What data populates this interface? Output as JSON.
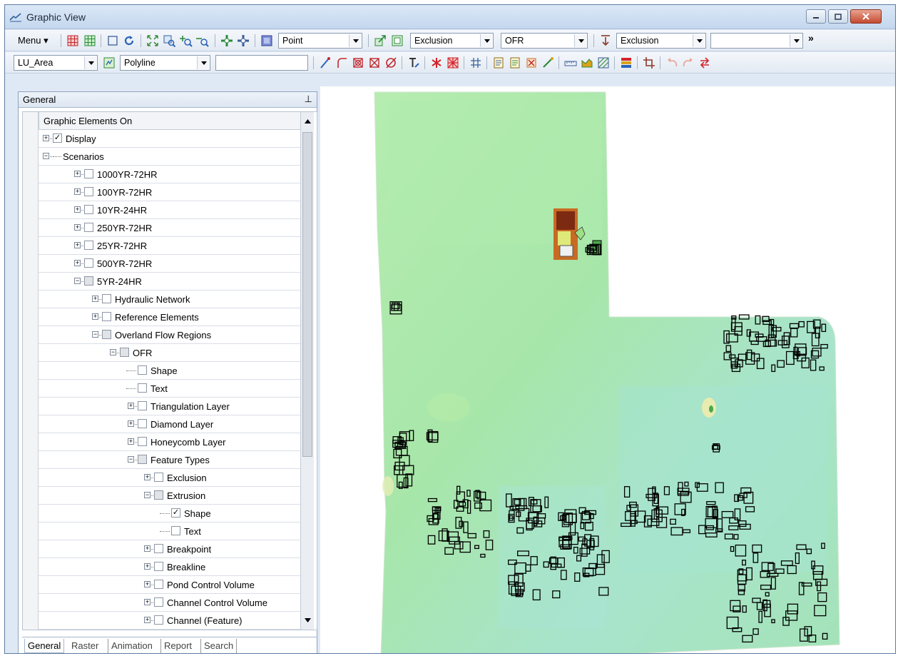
{
  "window": {
    "title": "Graphic View"
  },
  "toolbar1": {
    "menu_label": "Menu",
    "combo_point": "Point",
    "combo_exclusion1": "Exclusion",
    "combo_ofr": "OFR",
    "combo_exclusion2": "Exclusion",
    "combo_blank": "",
    "overflow": "»"
  },
  "toolbar2": {
    "combo_layer": "LU_Area",
    "combo_shape": "Polyline",
    "text_input": ""
  },
  "panel": {
    "title": "General",
    "pin": "⊥",
    "column_header": "Graphic Elements On",
    "tabs": [
      "General",
      "Raster",
      "Animation",
      "Report",
      "Search"
    ]
  },
  "tree": [
    {
      "label": "Display",
      "checked": true
    },
    {
      "label": "Scenarios",
      "checked": false
    },
    {
      "label": "1000YR-72HR"
    },
    {
      "label": "100YR-72HR"
    },
    {
      "label": "10YR-24HR"
    },
    {
      "label": "250YR-72HR"
    },
    {
      "label": "25YR-72HR"
    },
    {
      "label": "500YR-72HR"
    },
    {
      "label": "5YR-24HR"
    },
    {
      "label": "Hydraulic Network"
    },
    {
      "label": "Reference Elements"
    },
    {
      "label": "Overland Flow Regions"
    },
    {
      "label": "OFR"
    },
    {
      "label": "Shape"
    },
    {
      "label": "Text"
    },
    {
      "label": "Triangulation Layer"
    },
    {
      "label": "Diamond Layer"
    },
    {
      "label": "Honeycomb Layer"
    },
    {
      "label": "Feature Types"
    },
    {
      "label": "Exclusion"
    },
    {
      "label": "Extrusion"
    },
    {
      "label": "Shape",
      "checked": true
    },
    {
      "label": "Text"
    },
    {
      "label": "Breakpoint"
    },
    {
      "label": "Breakline"
    },
    {
      "label": "Pond Control Volume"
    },
    {
      "label": "Channel Control Volume"
    },
    {
      "label": "Channel (Feature)"
    }
  ],
  "icons": {
    "app": "graph-line-icon",
    "check": "✓",
    "expanded": "−",
    "collapsed": "+"
  },
  "colors": {
    "map_green": "#a9eaa4",
    "map_cyan": "#a8e4cf",
    "map_yellow": "#e6eea5",
    "building": "#000000",
    "pond_brown": "#7d2a12",
    "pond_orange": "#c86a24"
  }
}
